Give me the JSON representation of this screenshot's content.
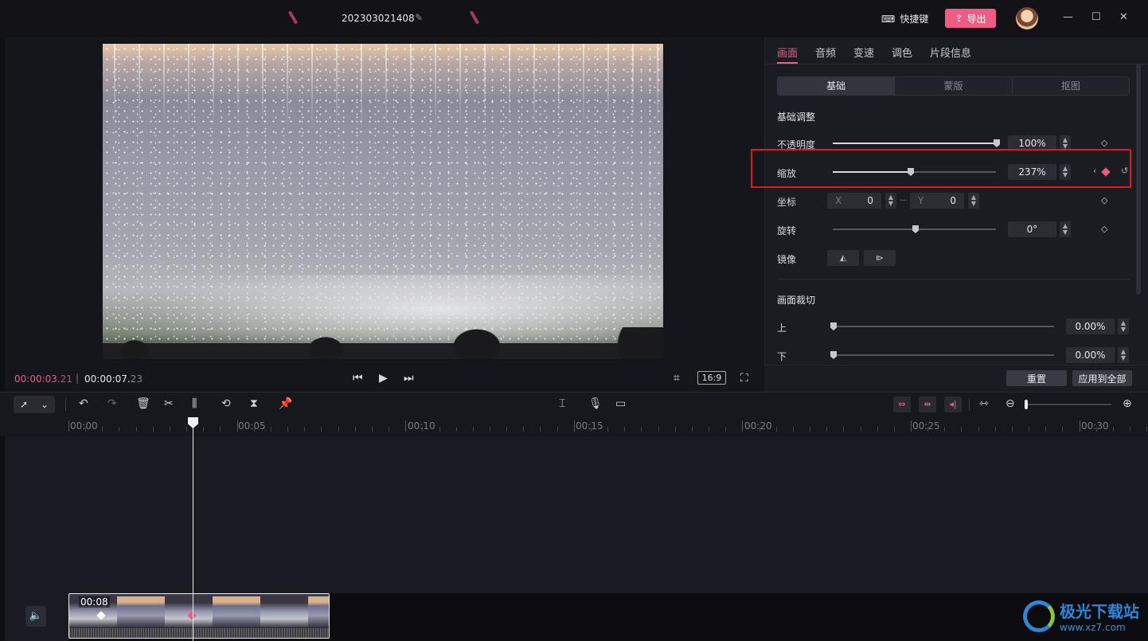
{
  "header": {
    "project_title": "202303021408",
    "shortcut_label": "快捷键",
    "export_label": "导出"
  },
  "player": {
    "current_time_main": "00:00:03.",
    "current_time_frames": "21",
    "total_time_main": "00:00:07.",
    "total_time_frames": "23",
    "aspect_ratio": "16:9"
  },
  "panel": {
    "tabs": [
      "画面",
      "音频",
      "变速",
      "调色",
      "片段信息"
    ],
    "active_tab": "画面",
    "subtabs": [
      "基础",
      "蒙版",
      "抠图"
    ],
    "active_subtab": "基础",
    "basic_section_title": "基础调整",
    "opacity": {
      "label": "不透明度",
      "value": "100%",
      "level": 1.0
    },
    "scale": {
      "label": "缩放",
      "value": "237%",
      "level": 0.48
    },
    "position": {
      "label": "坐标",
      "x_label": "X",
      "x_value": "0",
      "y_label": "Y",
      "y_value": "0"
    },
    "rotation": {
      "label": "旋转",
      "value": "0°",
      "level": 0.5
    },
    "mirror": {
      "label": "镜像"
    },
    "crop_section_title": "画面裁切",
    "crop_top": {
      "label": "上",
      "value": "0.00%",
      "level": 0
    },
    "crop_bottom": {
      "label": "下",
      "value": "0.00%",
      "level": 0
    },
    "reset_label": "重置",
    "apply_all_label": "应用到全部"
  },
  "timeline": {
    "ruler_labels": [
      "00:00",
      "00:05",
      "00:10",
      "00:15",
      "00:20",
      "00:25",
      "00:30"
    ],
    "clip_duration": "00:08"
  },
  "watermark": {
    "brand": "极光下载站",
    "url": "www.xz7.com"
  },
  "colors": {
    "accent": "#f05b85",
    "highlight_box": "#e0161c",
    "panel_bg": "#1b1b22"
  }
}
